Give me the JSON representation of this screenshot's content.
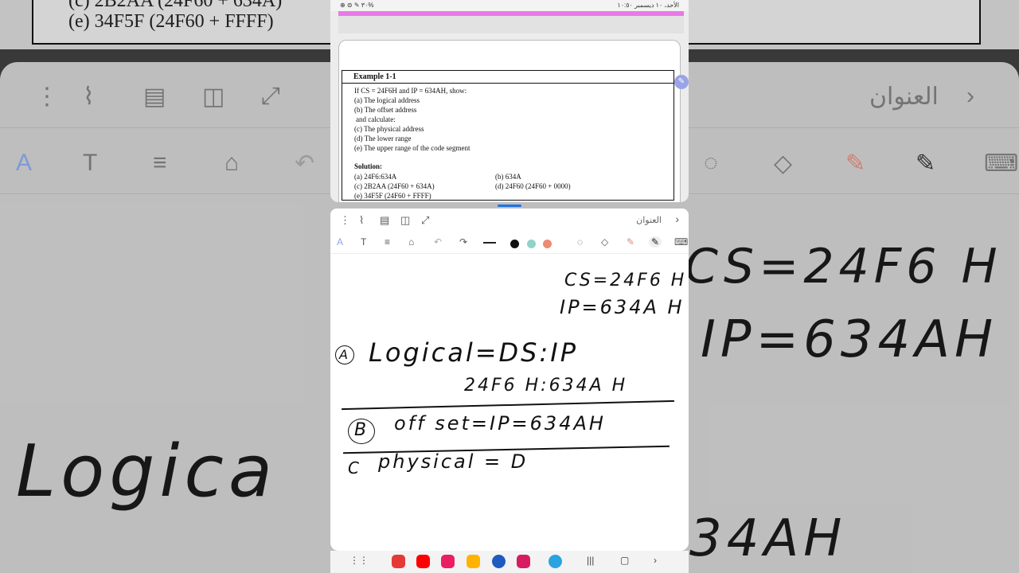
{
  "background": {
    "top_text_1": "(c) 2B2AA (24F60 + 634A)",
    "top_text_2": "(e) 34F5F (24F60 + FFFF)",
    "note_title": "العنوان",
    "handwriting": [
      "CS=24F6 H",
      "IP=634AH",
      "Logica",
      "34AH"
    ]
  },
  "status_bar": {
    "left_text": "⊕ ⊜ ✎ ٣٠%",
    "right_text": "الأحد، ١٠ ديسمبر ١٠:٥٠"
  },
  "pdf": {
    "example_title": "Example 1-1",
    "lines": [
      "If CS = 24F6H and IP = 634AH, show:",
      "(a) The logical address",
      "(b) The offset address",
      " and calculate:",
      "(c) The physical address",
      "(d) The lower range",
      "(e) The upper range of the code segment"
    ],
    "solution_label": "Solution:",
    "solution_left": [
      "(a) 24F6:634A",
      "(c) 2B2AA (24F60 + 634A)",
      "(e) 34F5F (24F60 + FFFF)"
    ],
    "solution_right": [
      "(b) 634A",
      "(d) 24F60 (24F60 + 0000)"
    ]
  },
  "notes": {
    "title": "العنوان",
    "handwriting": {
      "cs": "CS=24F6 H",
      "ip": "IP=634A H",
      "logical": "Logical=DS:IP",
      "logical_value": "24F6 H:634A H",
      "offset": "off set=IP=634AH",
      "physical": "physical = D",
      "label_a": "A",
      "label_b": "B",
      "label_c": "C"
    },
    "colors": [
      "#111111",
      "#8fd3c8",
      "#ef8a72"
    ]
  },
  "icons": {
    "more": "more-vert-icon",
    "attach": "paperclip-icon",
    "page": "page-icon",
    "book": "book-icon",
    "expand": "expand-icon"
  }
}
